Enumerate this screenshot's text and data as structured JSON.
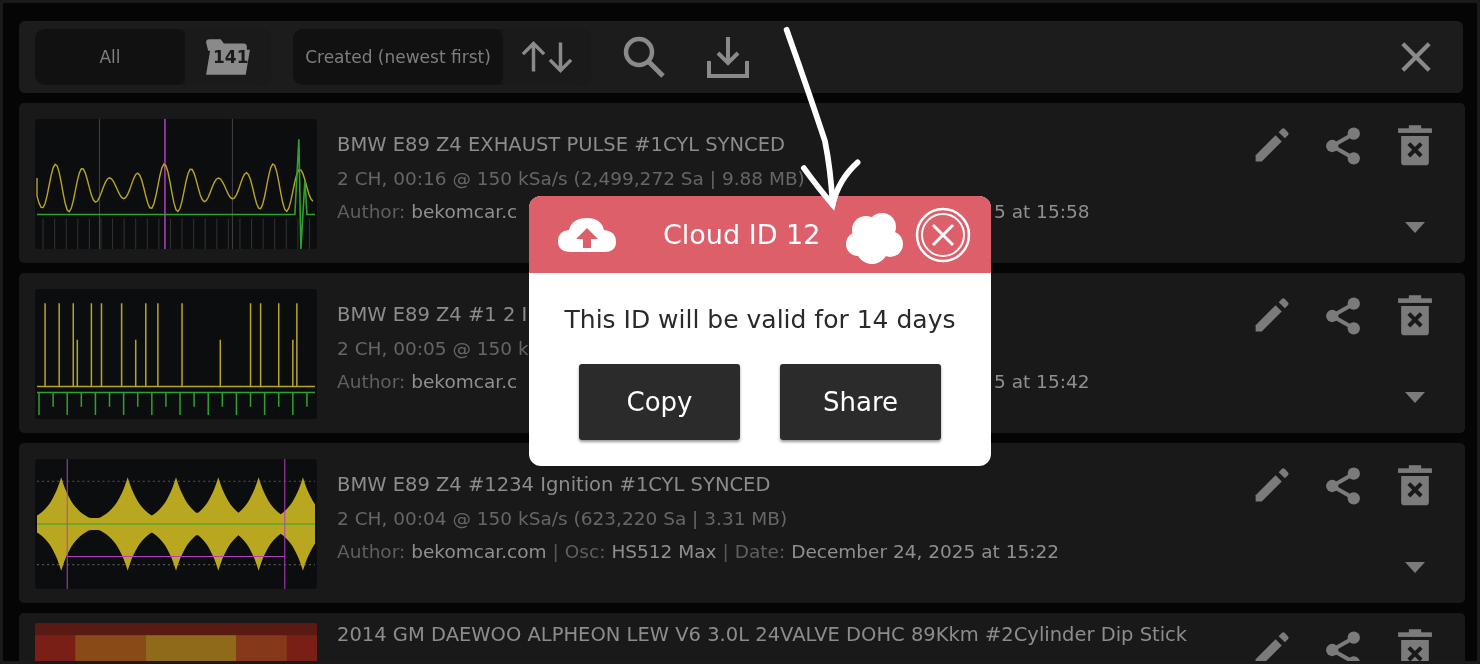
{
  "toolbar": {
    "filter": {
      "label": "All",
      "count": "141"
    },
    "sort": {
      "label": "Created (newest first)"
    }
  },
  "recordings": [
    {
      "thumbnail": {
        "kind": "sine"
      },
      "title": "BMW E89 Z4 EXHAUST PULSE #1CYL SYNCED",
      "info": "2 CH, 00:16 @ 150 kSa/s (2,499,272 Sa | 9.88 MB)",
      "meta": [
        {
          "kind": "label",
          "text": "Author:"
        },
        {
          "kind": "value",
          "text": "bekomcar.c"
        }
      ],
      "meta_tail": "5 at 15:58"
    },
    {
      "thumbnail": {
        "kind": "spikes"
      },
      "title": "BMW E89 Z4 #1 2 I",
      "info": "2 CH, 00:05 @ 150 k",
      "meta": [
        {
          "kind": "label",
          "text": "Author:"
        },
        {
          "kind": "value",
          "text": "bekomcar.c"
        }
      ],
      "meta_tail": "5 at 15:42"
    },
    {
      "thumbnail": {
        "kind": "bursts"
      },
      "title": "BMW E89 Z4 #1234 Ignition #1CYL SYNCED",
      "info": "2 CH, 00:04 @ 150 kSa/s (623,220 Sa | 3.31 MB)",
      "meta": [
        {
          "kind": "label",
          "text": "Author:"
        },
        {
          "kind": "value",
          "text": "bekomcar.com"
        },
        {
          "kind": "sep",
          "text": "|"
        },
        {
          "kind": "label",
          "text": "Osc:"
        },
        {
          "kind": "value",
          "text": "HS512 Max"
        },
        {
          "kind": "sep",
          "text": "|"
        },
        {
          "kind": "label",
          "text": "Date:"
        },
        {
          "kind": "value",
          "text": "December 24, 2025 at 15:22"
        }
      ]
    },
    {
      "thumbnail": {
        "kind": "heatmap"
      },
      "title": "2014 GM DAEWOO ALPHEON LEW V6 3.0L 24VALVE DOHC 89Kkm #2Cylinder Dip Stick"
    }
  ],
  "dialog": {
    "title": "Cloud ID 12",
    "message": "This ID will be valid for 14 days",
    "buttons": [
      "Copy",
      "Share"
    ]
  }
}
